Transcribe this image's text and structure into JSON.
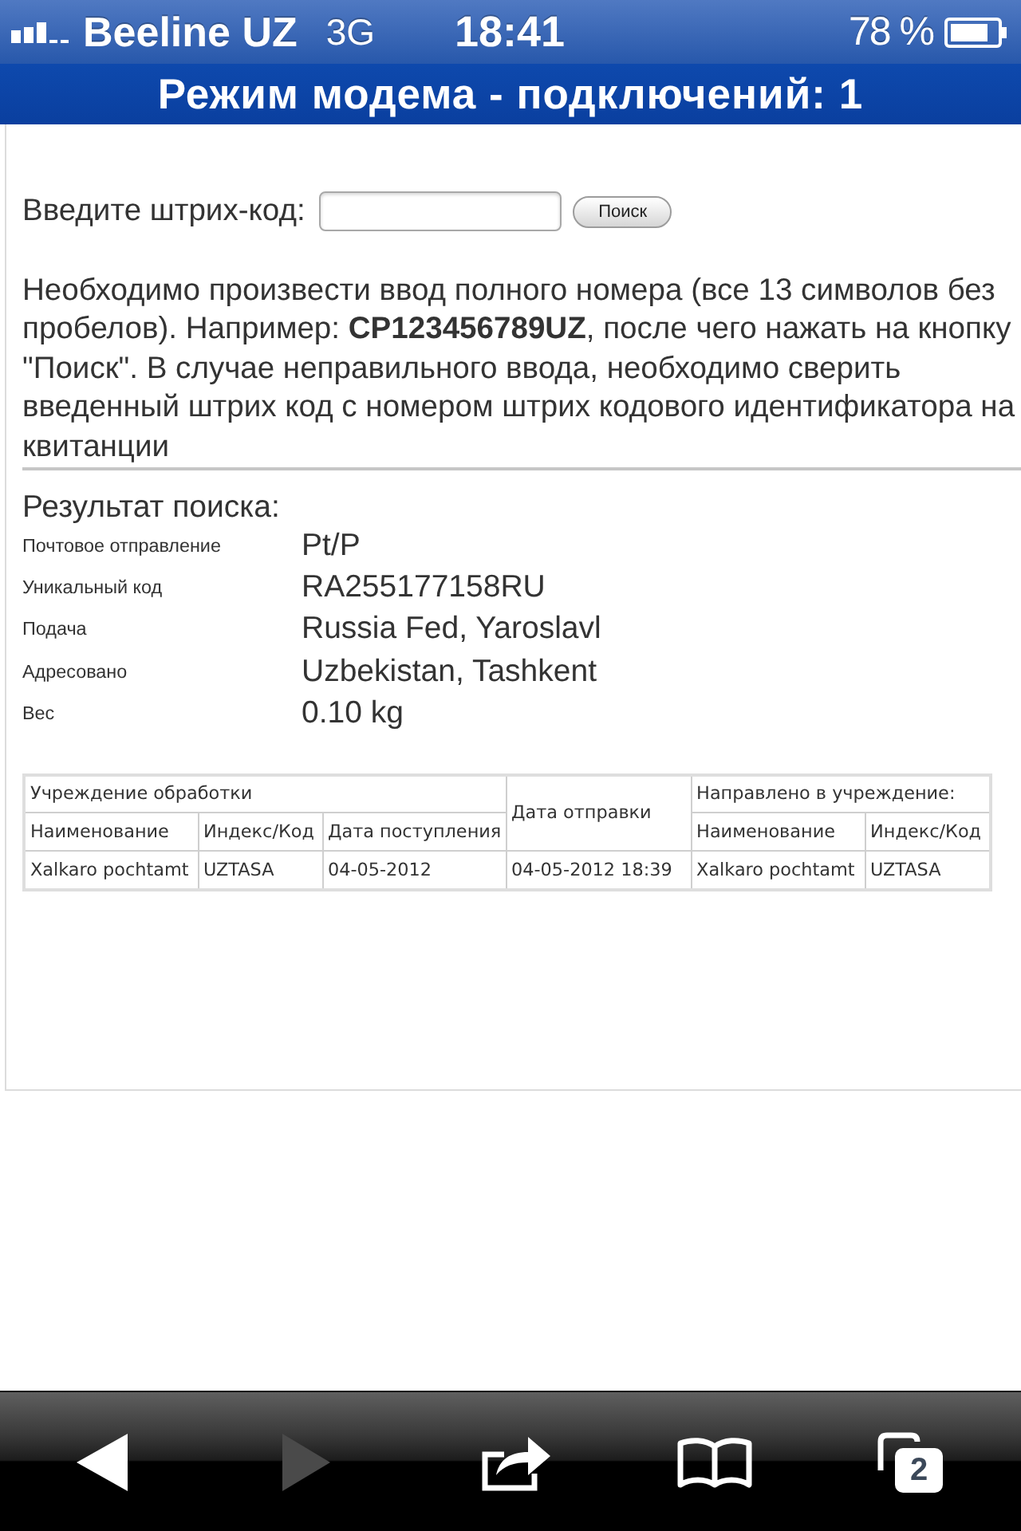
{
  "status_bar": {
    "carrier": "Beeline UZ",
    "network": "3G",
    "time": "18:41",
    "battery": "78 %"
  },
  "tethering_banner": {
    "title": "Режим модема - подключений: 1"
  },
  "search_form": {
    "label": "Введите штрих-код:",
    "button": "Поиск"
  },
  "instructions": "Необходимо произвести ввод полного номера (все 13 символов без\nпробелов). Например: **CP123456789UZ**, после чего нажать на кнопку\n\"Поиск\". В случае неправильного ввода, необходимо сверить\nвведенный штрих код с номером штрих кодового идентификатора на\nквитанции",
  "result": {
    "title": "Результат поиска:",
    "fields": [
      {
        "label": "Почтовое отправление",
        "value": "Pt/P"
      },
      {
        "label": "Уникальный код",
        "value": "RA255177158RU"
      },
      {
        "label": "Подача",
        "value": "Russia Fed, Yaroslavl"
      },
      {
        "label": "Адресовано",
        "value": "Uzbekistan, Tashkent"
      },
      {
        "label": "Вес",
        "value": "0.10 kg"
      }
    ]
  },
  "table": {
    "groups": [
      {
        "kind": "group",
        "title": "Учреждение обработки",
        "columns": [
          "Наименование",
          "Индекс/Код",
          "Дата поступления"
        ]
      },
      {
        "kind": "single",
        "title": "Дата отправки"
      },
      {
        "kind": "group",
        "title": "Направлено в учреждение:",
        "columns": [
          "Наименование",
          "Индекс/Код"
        ]
      }
    ],
    "rows": [
      [
        "Xalkaro pochtamt",
        "UZTASA",
        "04-05-2012",
        "04-05-2012 18:39",
        "Xalkaro pochtamt",
        "UZTASA"
      ]
    ]
  },
  "toolbar": {
    "buttons": [
      {
        "kind": "back",
        "disabled": false
      },
      {
        "kind": "forward",
        "disabled": true
      },
      {
        "kind": "share",
        "disabled": false
      },
      {
        "kind": "bookmarks",
        "disabled": false
      },
      {
        "kind": "tabs",
        "disabled": false,
        "count": "2"
      }
    ]
  }
}
